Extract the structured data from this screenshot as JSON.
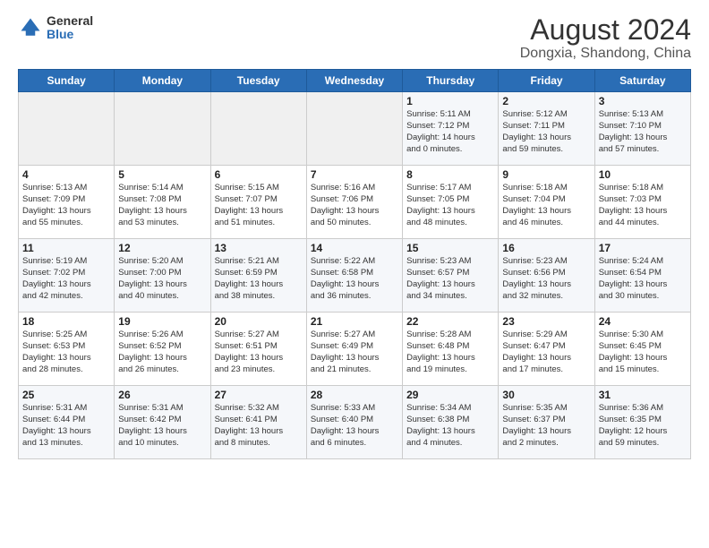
{
  "logo": {
    "general": "General",
    "blue": "Blue"
  },
  "title": "August 2024",
  "subtitle": "Dongxia, Shandong, China",
  "days_of_week": [
    "Sunday",
    "Monday",
    "Tuesday",
    "Wednesday",
    "Thursday",
    "Friday",
    "Saturday"
  ],
  "weeks": [
    [
      {
        "day": "",
        "info": ""
      },
      {
        "day": "",
        "info": ""
      },
      {
        "day": "",
        "info": ""
      },
      {
        "day": "",
        "info": ""
      },
      {
        "day": "1",
        "info": "Sunrise: 5:11 AM\nSunset: 7:12 PM\nDaylight: 14 hours\nand 0 minutes."
      },
      {
        "day": "2",
        "info": "Sunrise: 5:12 AM\nSunset: 7:11 PM\nDaylight: 13 hours\nand 59 minutes."
      },
      {
        "day": "3",
        "info": "Sunrise: 5:13 AM\nSunset: 7:10 PM\nDaylight: 13 hours\nand 57 minutes."
      }
    ],
    [
      {
        "day": "4",
        "info": "Sunrise: 5:13 AM\nSunset: 7:09 PM\nDaylight: 13 hours\nand 55 minutes."
      },
      {
        "day": "5",
        "info": "Sunrise: 5:14 AM\nSunset: 7:08 PM\nDaylight: 13 hours\nand 53 minutes."
      },
      {
        "day": "6",
        "info": "Sunrise: 5:15 AM\nSunset: 7:07 PM\nDaylight: 13 hours\nand 51 minutes."
      },
      {
        "day": "7",
        "info": "Sunrise: 5:16 AM\nSunset: 7:06 PM\nDaylight: 13 hours\nand 50 minutes."
      },
      {
        "day": "8",
        "info": "Sunrise: 5:17 AM\nSunset: 7:05 PM\nDaylight: 13 hours\nand 48 minutes."
      },
      {
        "day": "9",
        "info": "Sunrise: 5:18 AM\nSunset: 7:04 PM\nDaylight: 13 hours\nand 46 minutes."
      },
      {
        "day": "10",
        "info": "Sunrise: 5:18 AM\nSunset: 7:03 PM\nDaylight: 13 hours\nand 44 minutes."
      }
    ],
    [
      {
        "day": "11",
        "info": "Sunrise: 5:19 AM\nSunset: 7:02 PM\nDaylight: 13 hours\nand 42 minutes."
      },
      {
        "day": "12",
        "info": "Sunrise: 5:20 AM\nSunset: 7:00 PM\nDaylight: 13 hours\nand 40 minutes."
      },
      {
        "day": "13",
        "info": "Sunrise: 5:21 AM\nSunset: 6:59 PM\nDaylight: 13 hours\nand 38 minutes."
      },
      {
        "day": "14",
        "info": "Sunrise: 5:22 AM\nSunset: 6:58 PM\nDaylight: 13 hours\nand 36 minutes."
      },
      {
        "day": "15",
        "info": "Sunrise: 5:23 AM\nSunset: 6:57 PM\nDaylight: 13 hours\nand 34 minutes."
      },
      {
        "day": "16",
        "info": "Sunrise: 5:23 AM\nSunset: 6:56 PM\nDaylight: 13 hours\nand 32 minutes."
      },
      {
        "day": "17",
        "info": "Sunrise: 5:24 AM\nSunset: 6:54 PM\nDaylight: 13 hours\nand 30 minutes."
      }
    ],
    [
      {
        "day": "18",
        "info": "Sunrise: 5:25 AM\nSunset: 6:53 PM\nDaylight: 13 hours\nand 28 minutes."
      },
      {
        "day": "19",
        "info": "Sunrise: 5:26 AM\nSunset: 6:52 PM\nDaylight: 13 hours\nand 26 minutes."
      },
      {
        "day": "20",
        "info": "Sunrise: 5:27 AM\nSunset: 6:51 PM\nDaylight: 13 hours\nand 23 minutes."
      },
      {
        "day": "21",
        "info": "Sunrise: 5:27 AM\nSunset: 6:49 PM\nDaylight: 13 hours\nand 21 minutes."
      },
      {
        "day": "22",
        "info": "Sunrise: 5:28 AM\nSunset: 6:48 PM\nDaylight: 13 hours\nand 19 minutes."
      },
      {
        "day": "23",
        "info": "Sunrise: 5:29 AM\nSunset: 6:47 PM\nDaylight: 13 hours\nand 17 minutes."
      },
      {
        "day": "24",
        "info": "Sunrise: 5:30 AM\nSunset: 6:45 PM\nDaylight: 13 hours\nand 15 minutes."
      }
    ],
    [
      {
        "day": "25",
        "info": "Sunrise: 5:31 AM\nSunset: 6:44 PM\nDaylight: 13 hours\nand 13 minutes."
      },
      {
        "day": "26",
        "info": "Sunrise: 5:31 AM\nSunset: 6:42 PM\nDaylight: 13 hours\nand 10 minutes."
      },
      {
        "day": "27",
        "info": "Sunrise: 5:32 AM\nSunset: 6:41 PM\nDaylight: 13 hours\nand 8 minutes."
      },
      {
        "day": "28",
        "info": "Sunrise: 5:33 AM\nSunset: 6:40 PM\nDaylight: 13 hours\nand 6 minutes."
      },
      {
        "day": "29",
        "info": "Sunrise: 5:34 AM\nSunset: 6:38 PM\nDaylight: 13 hours\nand 4 minutes."
      },
      {
        "day": "30",
        "info": "Sunrise: 5:35 AM\nSunset: 6:37 PM\nDaylight: 13 hours\nand 2 minutes."
      },
      {
        "day": "31",
        "info": "Sunrise: 5:36 AM\nSunset: 6:35 PM\nDaylight: 12 hours\nand 59 minutes."
      }
    ]
  ]
}
